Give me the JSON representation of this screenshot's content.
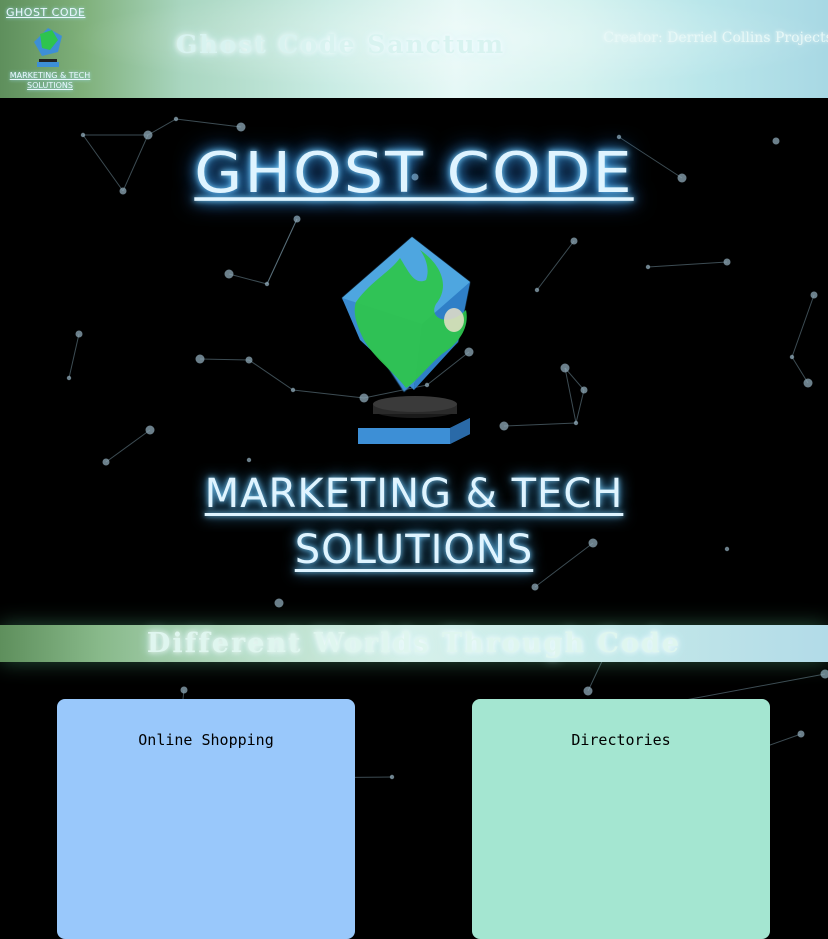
{
  "header": {
    "brand_top": "GHOST CODE",
    "brand_bottom": "MARKETING & TECH SOLUTIONS",
    "site_title": "Ghost Code Sanctum",
    "creator": "Creator: Derriel Collins Projects"
  },
  "hero": {
    "title": "GHOST CODE",
    "subtitle": " MARKETING & TECH SOLUTIONS"
  },
  "tagline": "Different Worlds Through Code",
  "cards": [
    {
      "title": "Online Shopping"
    },
    {
      "title": "Directories"
    }
  ],
  "colors": {
    "background": "#000000",
    "neon_text": "#dff4ff",
    "neon_glow": "#46b4ff",
    "card_blue": "#99c8fb",
    "card_green": "#a4e6d1",
    "cube_blue": "#3d8fd6",
    "cube_green": "#2ec44e"
  },
  "icons": {
    "logo": "cube-logo-icon"
  }
}
